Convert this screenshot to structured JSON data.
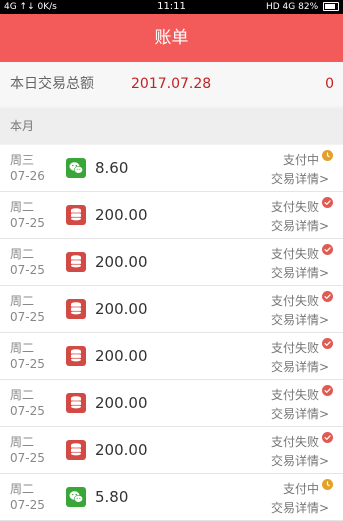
{
  "status_bar": {
    "left": "4G ↑↓ 0K/s",
    "time": "11:11",
    "right": "HD 4G 82%"
  },
  "header": {
    "title": "账单"
  },
  "summary": {
    "label": "本日交易总额",
    "date": "2017.07.28",
    "total": "0"
  },
  "section": {
    "title": "本月"
  },
  "transactions": [
    {
      "week": "周三",
      "date": "07-26",
      "method_icon": "wechat-pay-icon",
      "amount": "8.60",
      "status": "支付中",
      "status_icon": "clock-icon",
      "link": "交易详情>"
    },
    {
      "week": "周二",
      "date": "07-25",
      "method_icon": "coins-icon",
      "amount": "200.00",
      "status": "支付失败",
      "status_icon": "check-icon",
      "link": "交易详情>"
    },
    {
      "week": "周二",
      "date": "07-25",
      "method_icon": "coins-icon",
      "amount": "200.00",
      "status": "支付失败",
      "status_icon": "check-icon",
      "link": "交易详情>"
    },
    {
      "week": "周二",
      "date": "07-25",
      "method_icon": "coins-icon",
      "amount": "200.00",
      "status": "支付失败",
      "status_icon": "check-icon",
      "link": "交易详情>"
    },
    {
      "week": "周二",
      "date": "07-25",
      "method_icon": "coins-icon",
      "amount": "200.00",
      "status": "支付失败",
      "status_icon": "check-icon",
      "link": "交易详情>"
    },
    {
      "week": "周二",
      "date": "07-25",
      "method_icon": "coins-icon",
      "amount": "200.00",
      "status": "支付失败",
      "status_icon": "check-icon",
      "link": "交易详情>"
    },
    {
      "week": "周二",
      "date": "07-25",
      "method_icon": "coins-icon",
      "amount": "200.00",
      "status": "支付失败",
      "status_icon": "check-icon",
      "link": "交易详情>"
    },
    {
      "week": "周二",
      "date": "07-25",
      "method_icon": "wechat-pay-icon",
      "amount": "5.80",
      "status": "支付中",
      "status_icon": "clock-icon",
      "link": "交易详情>"
    }
  ],
  "colors": {
    "header": "#f35a5a",
    "accent_text": "#c32222",
    "pending": "#e2a129",
    "failed": "#e15a52",
    "wechat": "#3aa63a",
    "coins": "#d34a45"
  }
}
